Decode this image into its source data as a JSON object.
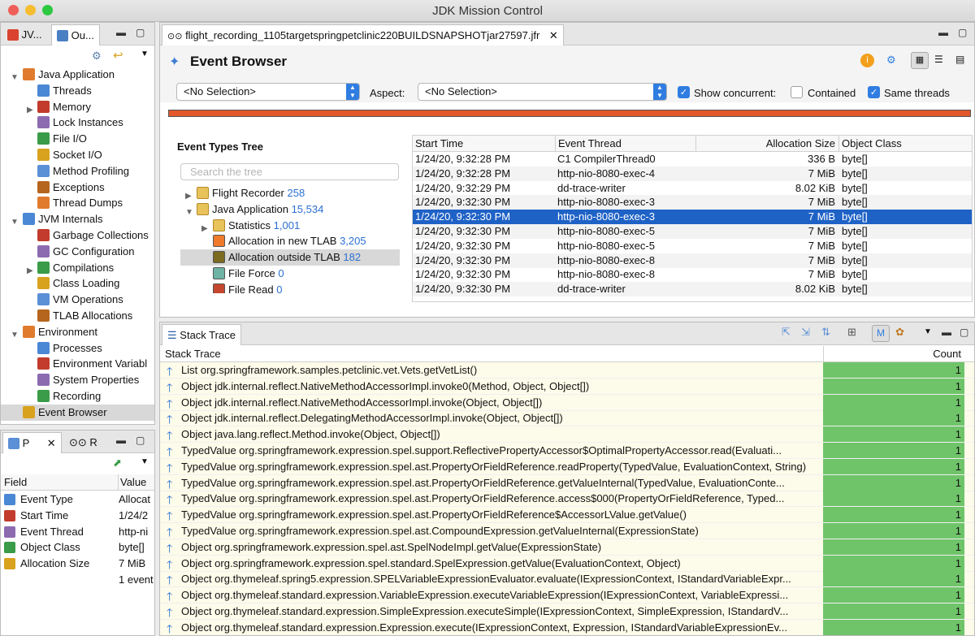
{
  "app": {
    "title": "JDK Mission Control"
  },
  "colors": {
    "accent": "#2f7de1",
    "selection": "#1f62c6",
    "count_bar": "#6fc46a",
    "stripe": "#e2572b"
  },
  "left_top": {
    "tabs": [
      "JV...",
      "Ou..."
    ],
    "tree": [
      {
        "label": "Java Application",
        "level": 0,
        "expanded": true,
        "icon": "java-app-icon"
      },
      {
        "label": "Threads",
        "level": 1,
        "icon": "threads-icon"
      },
      {
        "label": "Memory",
        "level": 1,
        "collapsed": true,
        "icon": "memory-icon"
      },
      {
        "label": "Lock Instances",
        "level": 1,
        "icon": "lock-icon"
      },
      {
        "label": "File I/O",
        "level": 1,
        "icon": "file-io-icon"
      },
      {
        "label": "Socket I/O",
        "level": 1,
        "icon": "socket-io-icon"
      },
      {
        "label": "Method Profiling",
        "level": 1,
        "icon": "method-profiling-icon"
      },
      {
        "label": "Exceptions",
        "level": 1,
        "icon": "exceptions-icon"
      },
      {
        "label": "Thread Dumps",
        "level": 1,
        "icon": "thread-dumps-icon"
      },
      {
        "label": "JVM Internals",
        "level": 0,
        "expanded": true,
        "icon": "jvm-internals-icon"
      },
      {
        "label": "Garbage Collections",
        "level": 1,
        "icon": "gc-icon"
      },
      {
        "label": "GC Configuration",
        "level": 1,
        "icon": "gc-config-icon"
      },
      {
        "label": "Compilations",
        "level": 1,
        "collapsed": true,
        "icon": "compilations-icon"
      },
      {
        "label": "Class Loading",
        "level": 1,
        "icon": "class-loading-icon"
      },
      {
        "label": "VM Operations",
        "level": 1,
        "icon": "vm-operations-icon"
      },
      {
        "label": "TLAB Allocations",
        "level": 1,
        "icon": "tlab-icon"
      },
      {
        "label": "Environment",
        "level": 0,
        "expanded": true,
        "icon": "environment-icon"
      },
      {
        "label": "Processes",
        "level": 1,
        "icon": "processes-icon"
      },
      {
        "label": "Environment Variabl",
        "level": 1,
        "icon": "env-vars-icon"
      },
      {
        "label": "System Properties",
        "level": 1,
        "icon": "system-props-icon"
      },
      {
        "label": "Recording",
        "level": 1,
        "icon": "recording-icon"
      },
      {
        "label": "Event Browser",
        "level": 0,
        "selected": true,
        "icon": "event-browser-icon"
      }
    ]
  },
  "left_bottom": {
    "tabs": [
      "P",
      "R"
    ],
    "headers": {
      "field": "Field",
      "value": "Value"
    },
    "rows": [
      {
        "field": "Event Type",
        "value": "Allocat",
        "icon": "event-type-icon"
      },
      {
        "field": "Start Time",
        "value": "1/24/2",
        "icon": "clock-icon"
      },
      {
        "field": "Event Thread",
        "value": "http-ni",
        "icon": "thread-icon"
      },
      {
        "field": "Object Class",
        "value": "byte[]",
        "icon": "class-icon"
      },
      {
        "field": "Allocation Size",
        "value": "7 MiB",
        "icon": "binary-icon"
      },
      {
        "field": "",
        "value": "1 event"
      }
    ]
  },
  "editor": {
    "tab": "flight_recording_1105targetspringpetclinic220BUILDSNAPSHOTjar27597.jfr",
    "heading": "Event Browser",
    "selection1": "<No Selection>",
    "aspect_label": "Aspect:",
    "selection2": "<No Selection>",
    "show_concurrent": "Show concurrent:",
    "contained": "Contained",
    "same_threads": "Same threads",
    "event_types_title": "Event Types Tree",
    "search_placeholder": "Search the tree",
    "types": [
      {
        "label": "Flight Recorder",
        "count": "258",
        "folder": true,
        "level": 0
      },
      {
        "label": "Java Application",
        "count": "15,534",
        "folder": true,
        "open": true,
        "level": 0
      },
      {
        "label": "Statistics",
        "count": "1,001",
        "folder": true,
        "level": 1
      },
      {
        "label": "Allocation in new TLAB",
        "count": "3,205",
        "color": "#f07a2c",
        "level": 1
      },
      {
        "label": "Allocation outside TLAB",
        "count": "182",
        "color": "#7b6b21",
        "level": 1,
        "selected": true
      },
      {
        "label": "File Force",
        "count": "0",
        "color": "#6fb3a5",
        "level": 1
      },
      {
        "label": "File Read",
        "count": "0",
        "color": "#c4472f",
        "level": 1
      }
    ],
    "table": {
      "headers": [
        "Start Time",
        "Event Thread",
        "Allocation Size",
        "Object Class"
      ],
      "rows": [
        [
          "1/24/20, 9:32:28 PM",
          "C1 CompilerThread0",
          "336 B",
          "byte[]"
        ],
        [
          "1/24/20, 9:32:28 PM",
          "http-nio-8080-exec-4",
          "7 MiB",
          "byte[]"
        ],
        [
          "1/24/20, 9:32:29 PM",
          "dd-trace-writer",
          "8.02 KiB",
          "byte[]"
        ],
        [
          "1/24/20, 9:32:30 PM",
          "http-nio-8080-exec-3",
          "7 MiB",
          "byte[]"
        ],
        [
          "1/24/20, 9:32:30 PM",
          "http-nio-8080-exec-3",
          "7 MiB",
          "byte[]"
        ],
        [
          "1/24/20, 9:32:30 PM",
          "http-nio-8080-exec-5",
          "7 MiB",
          "byte[]"
        ],
        [
          "1/24/20, 9:32:30 PM",
          "http-nio-8080-exec-5",
          "7 MiB",
          "byte[]"
        ],
        [
          "1/24/20, 9:32:30 PM",
          "http-nio-8080-exec-8",
          "7 MiB",
          "byte[]"
        ],
        [
          "1/24/20, 9:32:30 PM",
          "http-nio-8080-exec-8",
          "7 MiB",
          "byte[]"
        ],
        [
          "1/24/20, 9:32:30 PM",
          "dd-trace-writer",
          "8.02 KiB",
          "byte[]"
        ]
      ],
      "selected_index": 4
    }
  },
  "stack": {
    "tab": "Stack Trace",
    "headers": {
      "trace": "Stack Trace",
      "count": "Count"
    },
    "rows": [
      {
        "text": "List org.springframework.samples.petclinic.vet.Vets.getVetList()",
        "count": "1"
      },
      {
        "text": "Object jdk.internal.reflect.NativeMethodAccessorImpl.invoke0(Method, Object, Object[])",
        "count": "1"
      },
      {
        "text": "Object jdk.internal.reflect.NativeMethodAccessorImpl.invoke(Object, Object[])",
        "count": "1"
      },
      {
        "text": "Object jdk.internal.reflect.DelegatingMethodAccessorImpl.invoke(Object, Object[])",
        "count": "1"
      },
      {
        "text": "Object java.lang.reflect.Method.invoke(Object, Object[])",
        "count": "1"
      },
      {
        "text": "TypedValue org.springframework.expression.spel.support.ReflectivePropertyAccessor$OptimalPropertyAccessor.read(Evaluati...",
        "count": "1"
      },
      {
        "text": "TypedValue org.springframework.expression.spel.ast.PropertyOrFieldReference.readProperty(TypedValue, EvaluationContext, String)",
        "count": "1"
      },
      {
        "text": "TypedValue org.springframework.expression.spel.ast.PropertyOrFieldReference.getValueInternal(TypedValue, EvaluationConte...",
        "count": "1"
      },
      {
        "text": "TypedValue org.springframework.expression.spel.ast.PropertyOrFieldReference.access$000(PropertyOrFieldReference, Typed...",
        "count": "1"
      },
      {
        "text": "TypedValue org.springframework.expression.spel.ast.PropertyOrFieldReference$AccessorLValue.getValue()",
        "count": "1"
      },
      {
        "text": "TypedValue org.springframework.expression.spel.ast.CompoundExpression.getValueInternal(ExpressionState)",
        "count": "1"
      },
      {
        "text": "Object org.springframework.expression.spel.ast.SpelNodeImpl.getValue(ExpressionState)",
        "count": "1"
      },
      {
        "text": "Object org.springframework.expression.spel.standard.SpelExpression.getValue(EvaluationContext, Object)",
        "count": "1"
      },
      {
        "text": "Object org.thymeleaf.spring5.expression.SPELVariableExpressionEvaluator.evaluate(IExpressionContext, IStandardVariableExpr...",
        "count": "1"
      },
      {
        "text": "Object org.thymeleaf.standard.expression.VariableExpression.executeVariableExpression(IExpressionContext, VariableExpressi...",
        "count": "1"
      },
      {
        "text": "Object org.thymeleaf.standard.expression.SimpleExpression.executeSimple(IExpressionContext, SimpleExpression, IStandardV...",
        "count": "1"
      },
      {
        "text": "Object org.thymeleaf.standard.expression.Expression.execute(IExpressionContext, Expression, IStandardVariableExpressionEv...",
        "count": "1"
      }
    ]
  }
}
